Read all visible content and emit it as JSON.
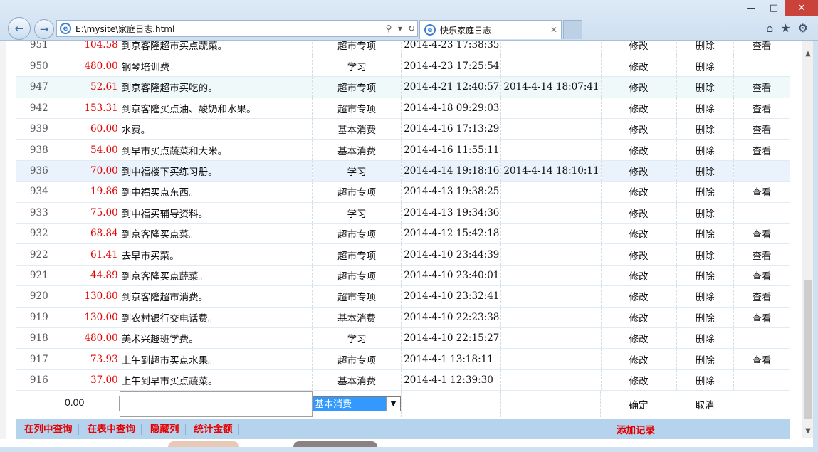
{
  "browser": {
    "address_url": "E:\\mysite\\家庭日志.html",
    "tab_title": "快乐家庭日志",
    "window_buttons": [
      "minimize-icon",
      "maximize-icon",
      "close-icon"
    ],
    "toolbar_icons": [
      "home-icon",
      "favorites-icon",
      "gear-icon"
    ]
  },
  "records": [
    {
      "id": "951",
      "amount": "104.58",
      "desc": "到京客隆超市买点蔬菜。",
      "category": "超市专项",
      "time1": "2014-4-23 17:38:35",
      "time2": "",
      "edit": "修改",
      "del": "删除",
      "view": "查看"
    },
    {
      "id": "950",
      "amount": "480.00",
      "desc": "钢琴培训费",
      "category": "学习",
      "time1": "2014-4-23 17:25:54",
      "time2": "",
      "edit": "修改",
      "del": "删除",
      "view": ""
    },
    {
      "id": "947",
      "amount": "52.61",
      "desc": "到京客隆超市买吃的。",
      "category": "超市专项",
      "time1": "2014-4-21 12:40:57",
      "time2": "2014-4-14 18:07:41",
      "edit": "修改",
      "del": "删除",
      "view": "查看"
    },
    {
      "id": "942",
      "amount": "153.31",
      "desc": "到京客隆买点油、酸奶和水果。",
      "category": "超市专项",
      "time1": "2014-4-18 09:29:03",
      "time2": "",
      "edit": "修改",
      "del": "删除",
      "view": "查看"
    },
    {
      "id": "939",
      "amount": "60.00",
      "desc": "水费。",
      "category": "基本消费",
      "time1": "2014-4-16 17:13:29",
      "time2": "",
      "edit": "修改",
      "del": "删除",
      "view": "查看"
    },
    {
      "id": "938",
      "amount": "54.00",
      "desc": "到早市买点蔬菜和大米。",
      "category": "基本消费",
      "time1": "2014-4-16 11:55:11",
      "time2": "",
      "edit": "修改",
      "del": "删除",
      "view": "查看"
    },
    {
      "id": "936",
      "amount": "70.00",
      "desc": "到中福楼下买练习册。",
      "category": "学习",
      "time1": "2014-4-14 19:18:16",
      "time2": "2014-4-14 18:10:11",
      "edit": "修改",
      "del": "删除",
      "view": ""
    },
    {
      "id": "934",
      "amount": "19.86",
      "desc": "到中福买点东西。",
      "category": "超市专项",
      "time1": "2014-4-13 19:38:25",
      "time2": "",
      "edit": "修改",
      "del": "删除",
      "view": "查看"
    },
    {
      "id": "933",
      "amount": "75.00",
      "desc": "到中福买辅导资料。",
      "category": "学习",
      "time1": "2014-4-13 19:34:36",
      "time2": "",
      "edit": "修改",
      "del": "删除",
      "view": ""
    },
    {
      "id": "932",
      "amount": "68.84",
      "desc": "到京客隆买点菜。",
      "category": "超市专项",
      "time1": "2014-4-12 15:42:18",
      "time2": "",
      "edit": "修改",
      "del": "删除",
      "view": "查看"
    },
    {
      "id": "922",
      "amount": "61.41",
      "desc": "去早市买菜。",
      "category": "超市专项",
      "time1": "2014-4-10 23:44:39",
      "time2": "",
      "edit": "修改",
      "del": "删除",
      "view": "查看"
    },
    {
      "id": "921",
      "amount": "44.89",
      "desc": "到京客隆买点蔬菜。",
      "category": "超市专项",
      "time1": "2014-4-10 23:40:01",
      "time2": "",
      "edit": "修改",
      "del": "删除",
      "view": "查看"
    },
    {
      "id": "920",
      "amount": "130.80",
      "desc": "到京客隆超市消费。",
      "category": "超市专项",
      "time1": "2014-4-10 23:32:41",
      "time2": "",
      "edit": "修改",
      "del": "删除",
      "view": "查看"
    },
    {
      "id": "919",
      "amount": "130.00",
      "desc": "到农村银行交电话费。",
      "category": "基本消费",
      "time1": "2014-4-10 22:23:38",
      "time2": "",
      "edit": "修改",
      "del": "删除",
      "view": "查看"
    },
    {
      "id": "918",
      "amount": "480.00",
      "desc": "美术兴趣班学费。",
      "category": "学习",
      "time1": "2014-4-10 22:15:27",
      "time2": "",
      "edit": "修改",
      "del": "删除",
      "view": ""
    },
    {
      "id": "917",
      "amount": "73.93",
      "desc": "上午到超市买点水果。",
      "category": "超市专项",
      "time1": "2014-4-1 13:18:11",
      "time2": "",
      "edit": "修改",
      "del": "删除",
      "view": "查看"
    },
    {
      "id": "916",
      "amount": "37.00",
      "desc": "上午到早市买点蔬菜。",
      "category": "基本消费",
      "time1": "2014-4-1 12:39:30",
      "time2": "",
      "edit": "修改",
      "del": "删除",
      "view": ""
    }
  ],
  "entry": {
    "amount_value": "0.00",
    "category_selected": "基本消费",
    "confirm_label": "确定",
    "cancel_label": "取消"
  },
  "footer": {
    "links": [
      "在列中查询",
      "在表中查询",
      "隐藏列",
      "统计金额"
    ],
    "add_label": "添加记录"
  },
  "colors": {
    "amount": "#e60000",
    "footer_bg": "#b6d3ee",
    "footer_text": "#e60000",
    "highlight_row": "#eaf2fb"
  }
}
